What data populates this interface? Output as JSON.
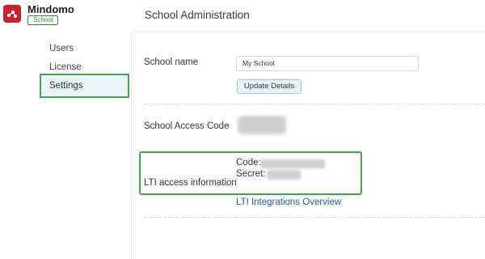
{
  "brand": {
    "name": "Mindomo",
    "badge": "School"
  },
  "header": {
    "title": "School Administration"
  },
  "sidebar": {
    "items": [
      {
        "label": "Users"
      },
      {
        "label": "License"
      },
      {
        "label": "Settings",
        "active": true
      }
    ]
  },
  "school_name": {
    "label": "School name",
    "value": "My School",
    "button_label": "Update Details"
  },
  "access_code": {
    "label": "School Access Code"
  },
  "lti": {
    "label": "LTI access information",
    "code_label": "Code:",
    "secret_label": "Secret:",
    "link_label": "LTI Integrations Overview"
  },
  "colors": {
    "brand": "#c9222e",
    "highlight": "#3fa84a",
    "link": "#1f5fa8"
  }
}
